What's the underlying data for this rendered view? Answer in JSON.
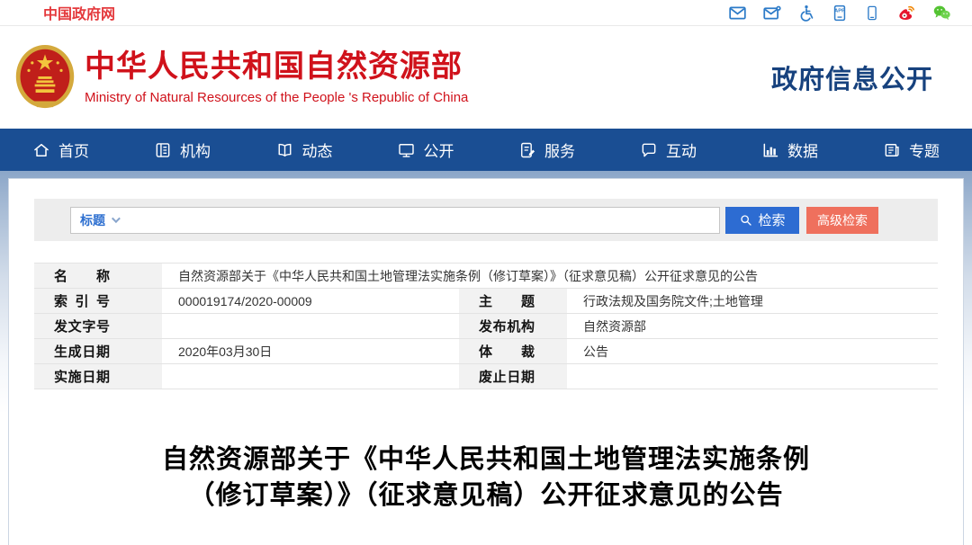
{
  "topbar": {
    "site_name": "中国政府网",
    "icons": [
      {
        "name": "mail-icon"
      },
      {
        "name": "mail-subscribe-icon"
      },
      {
        "name": "accessibility-icon"
      },
      {
        "name": "app-icon"
      },
      {
        "name": "mobile-icon"
      },
      {
        "name": "weibo-icon"
      },
      {
        "name": "wechat-icon"
      }
    ]
  },
  "header": {
    "cn_title": "中华人民共和国自然资源部",
    "en_title": "Ministry of Natural Resources of the People 's Republic of China",
    "section_title": "政府信息公开"
  },
  "nav": {
    "items": [
      {
        "label": "首页",
        "icon": "home-icon"
      },
      {
        "label": "机构",
        "icon": "org-icon"
      },
      {
        "label": "动态",
        "icon": "book-icon"
      },
      {
        "label": "公开",
        "icon": "monitor-icon"
      },
      {
        "label": "服务",
        "icon": "service-icon"
      },
      {
        "label": "互动",
        "icon": "chat-icon"
      },
      {
        "label": "数据",
        "icon": "chart-icon"
      },
      {
        "label": "专题",
        "icon": "newspaper-icon"
      }
    ]
  },
  "search": {
    "field_selector": "标题",
    "input_value": "",
    "search_button": "检索",
    "advanced_button": "高级检索"
  },
  "meta_table": {
    "name_label": "名称",
    "name_value": "自然资源部关于《中华人民共和国土地管理法实施条例（修订草案）》（征求意见稿）公开征求意见的公告",
    "rows": [
      {
        "l1": "索引号",
        "v1": "000019174/2020-00009",
        "l2": "主题",
        "v2": "行政法规及国务院文件;土地管理"
      },
      {
        "l1": "发文字号",
        "v1": "",
        "l2": "发布机构",
        "v2": "自然资源部"
      },
      {
        "l1": "生成日期",
        "v1": "2020年03月30日",
        "l2": "体裁",
        "v2": "公告"
      },
      {
        "l1": "实施日期",
        "v1": "",
        "l2": "废止日期",
        "v2": ""
      }
    ]
  },
  "article": {
    "title": "自然资源部关于《中华人民共和国土地管理法实施条例（修订草案）》（征求意见稿）公开征求意见的公告"
  },
  "colors": {
    "brand_red": "#d0121b",
    "topbar_red": "#e4393c",
    "nav_blue": "#1a4e93",
    "section_blue": "#17427e",
    "search_button_blue": "#2d6cd2",
    "advanced_button_salmon": "#ef705d",
    "label_cell_gray": "#f2f2f2",
    "band_blue_gray": "#8ba6c8"
  }
}
